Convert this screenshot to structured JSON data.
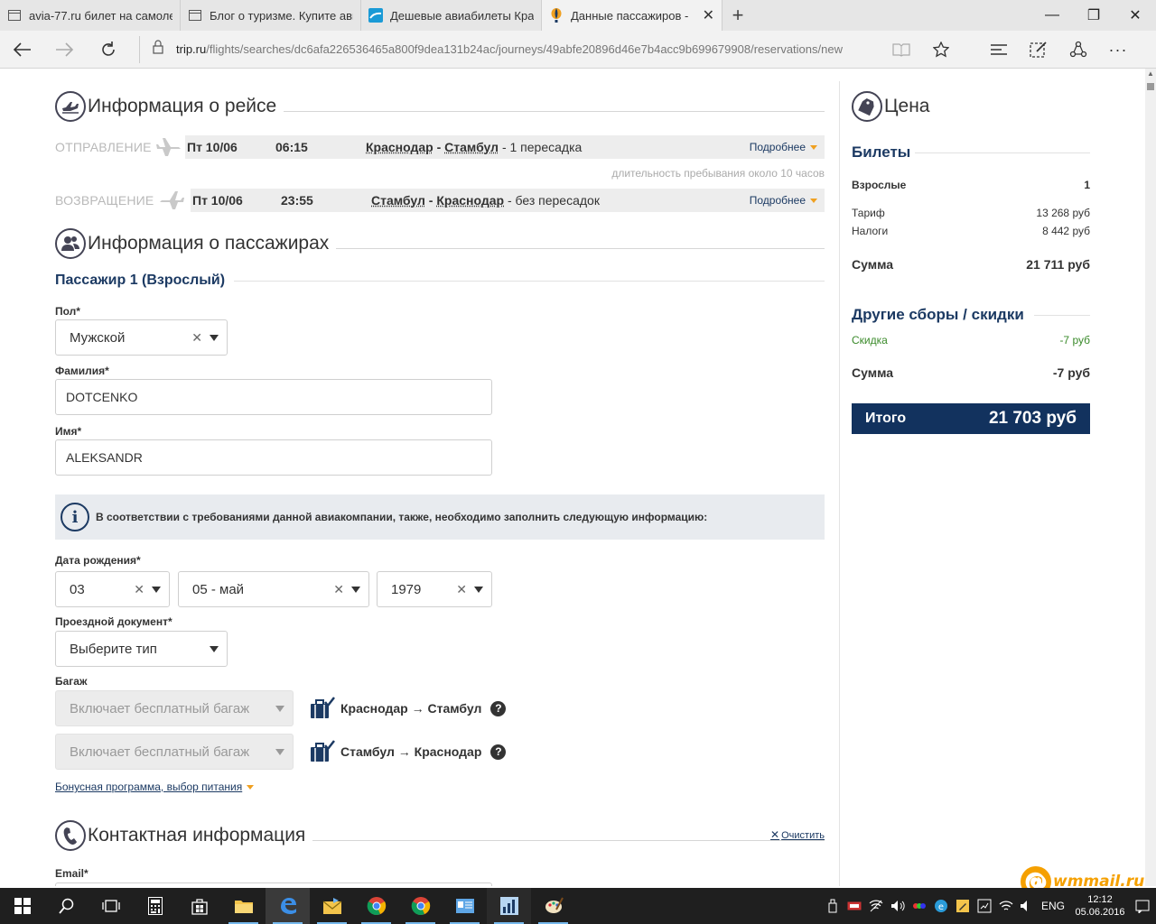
{
  "browser": {
    "tabs": [
      {
        "title": "avia-77.ru билет на самоле",
        "icon": "page-icon"
      },
      {
        "title": "Блог о туризме. Купите ави",
        "icon": "page-icon"
      },
      {
        "title": "Дешевые авиабилеты Крас",
        "icon": "wave-icon"
      },
      {
        "title": "Данные пассажиров -",
        "icon": "balloon-icon",
        "active": true
      }
    ],
    "url_domain": "trip.ru",
    "url_path": "/flights/searches/dc6afa226536465a800f9dea131b24ac/journeys/49abfe20896d46e7b4acc9b699679908/reservations/new"
  },
  "flight_info": {
    "title": "Информация о рейсе",
    "outbound": {
      "direction": "ОТПРАВЛЕНИЕ",
      "date": "Пт 10/06",
      "time": "06:15",
      "from": "Краснодар",
      "to": "Стамбул",
      "separator": " - ",
      "stops": " - 1 пересадка",
      "more": "Подробнее"
    },
    "stay_note": "длительность пребывания около 10 часов",
    "return": {
      "direction": "ВОЗВРАЩЕНИЕ",
      "date": "Пт 10/06",
      "time": "23:55",
      "from": "Стамбул",
      "to": "Краснодар",
      "separator": " - ",
      "stops": " - без пересадок",
      "more": "Подробнее"
    }
  },
  "passengers": {
    "title": "Информация о пассажирах",
    "passenger_title": "Пассажир 1 (Взрослый)",
    "gender_label": "Пол*",
    "gender_value": "Мужской",
    "surname_label": "Фамилия*",
    "surname_value": "DOTCENKO",
    "name_label": "Имя*",
    "name_value": "ALEKSANDR",
    "info_text": "В соответствии с требованиями данной авиакомпании, также, необходимо заполнить следующую информацию:",
    "birth_label": "Дата рождения*",
    "birth_day": "03",
    "birth_month": "05 - май",
    "birth_year": "1979",
    "doc_label": "Проездной документ*",
    "doc_value": "Выберите тип",
    "baggage_label": "Багаж",
    "baggage": [
      {
        "value": "Включает бесплатный багаж",
        "route": "Краснодар → Стамбул"
      },
      {
        "value": "Включает бесплатный багаж",
        "route": "Стамбул → Краснодар"
      }
    ],
    "bonus_link": "Бонусная программа, выбор питания"
  },
  "contact": {
    "title": "Контактная информация",
    "clear": "Очистить",
    "email_label": "Email*"
  },
  "price": {
    "title": "Цена",
    "tickets_heading": "Билеты",
    "adults_label": "Взрослые",
    "adults_count": "1",
    "fare_label": "Тариф",
    "fare_value": "13 268 руб",
    "taxes_label": "Налоги",
    "taxes_value": "8 442 руб",
    "sum_label": "Сумма",
    "sum_value": "21 711 руб",
    "other_heading": "Другие сборы / скидки",
    "discount_label": "Скидка",
    "discount_value": "-7 руб",
    "sum2_label": "Сумма",
    "sum2_value": "-7 руб",
    "total_label": "Итого",
    "total_value": "21 703 руб",
    "accent_color": "#12325e",
    "discount_color": "#3a8a2a"
  },
  "watermark": "wmmail.ru",
  "taskbar": {
    "lang": "ENG",
    "time": "12:12",
    "date": "05.06.2016"
  }
}
